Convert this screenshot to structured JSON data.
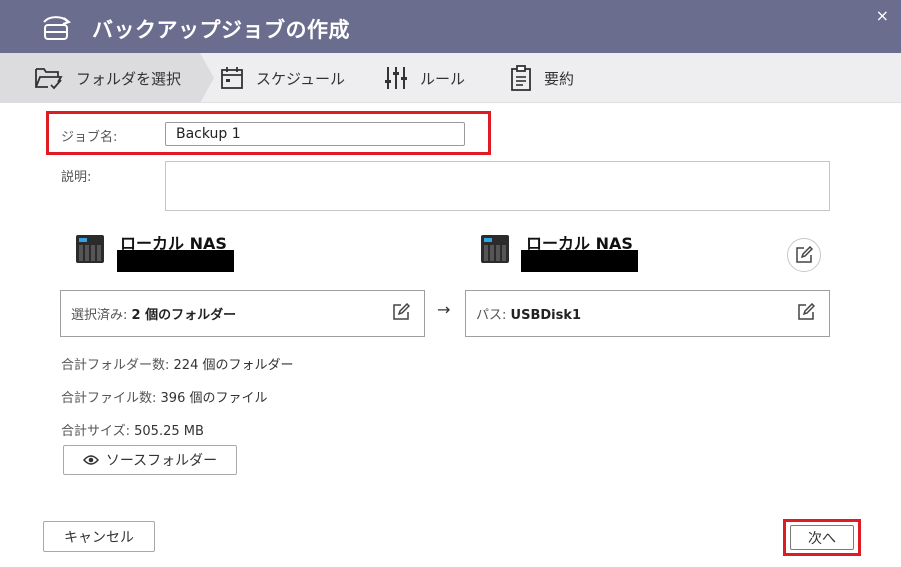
{
  "header": {
    "title": "バックアップジョブの作成",
    "close": "×",
    "icon": "backup-cylinder-icon"
  },
  "steps": [
    {
      "label": "フォルダを選択",
      "icon": "folder-check-icon",
      "active": true
    },
    {
      "label": "スケジュール",
      "icon": "calendar-icon",
      "active": false
    },
    {
      "label": "ルール",
      "icon": "sliders-icon",
      "active": false
    },
    {
      "label": "要約",
      "icon": "clipboard-icon",
      "active": false
    }
  ],
  "form": {
    "job_name_label": "ジョブ名:",
    "job_name_value": "Backup 1",
    "description_label": "説明:",
    "description_value": ""
  },
  "source": {
    "nas_name": "ローカル NAS",
    "selected_prefix": "選択済み:",
    "selected_value": "2 個のフォルダー"
  },
  "destination": {
    "nas_name": "ローカル NAS",
    "path_prefix": "パス:",
    "path_value": "USBDisk1"
  },
  "arrow": "→",
  "stats": {
    "folders_label": "合計フォルダー数:",
    "folders_value": "224 個のフォルダー",
    "files_label": "合計ファイル数:",
    "files_value": "396 個のファイル",
    "size_label": "合計サイズ:",
    "size_value": "505.25 MB"
  },
  "buttons": {
    "source_folder": "ソースフォルダー",
    "cancel": "キャンセル",
    "next": "次へ"
  },
  "colors": {
    "header_bg": "#6a6d8d",
    "highlight": "#e01b24"
  }
}
